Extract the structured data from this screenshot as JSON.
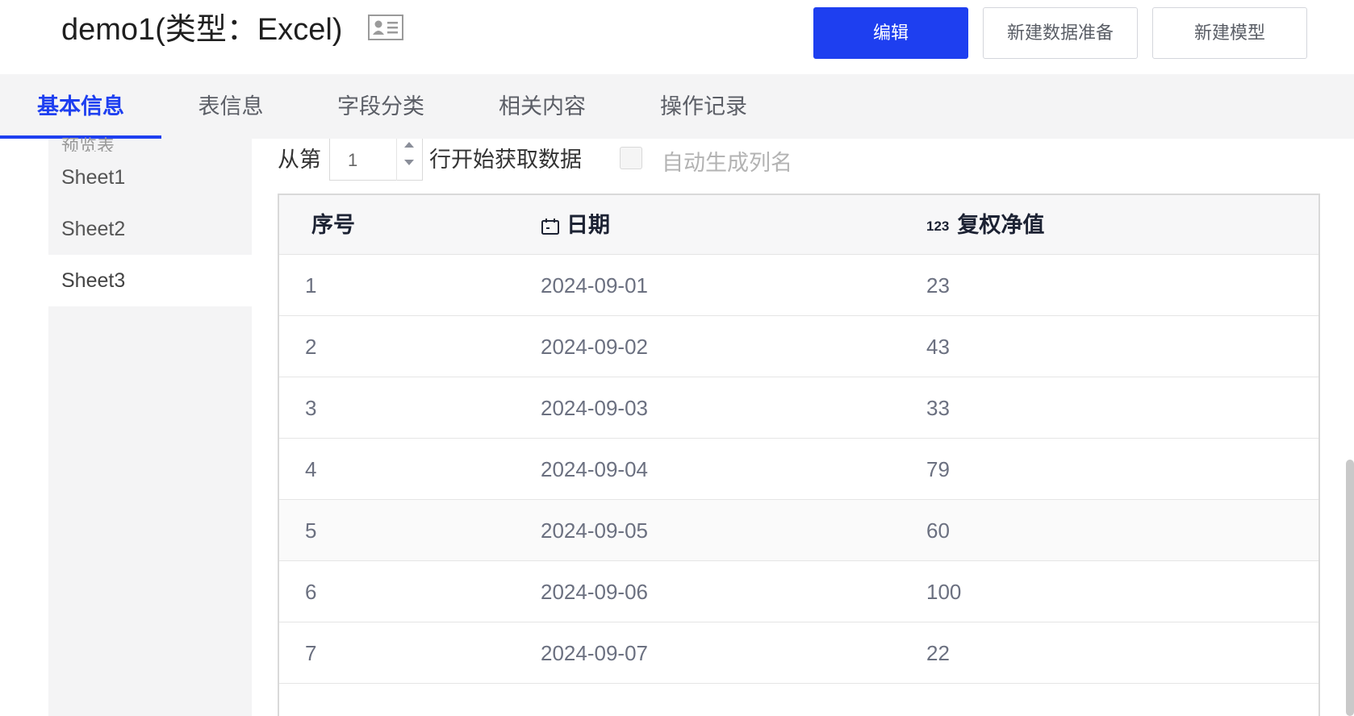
{
  "header": {
    "title": "demo1(类型：Excel)",
    "title_icon": "id-card-icon",
    "buttons": {
      "edit": "编辑",
      "new_prep": "新建数据准备",
      "new_model": "新建模型"
    }
  },
  "tabs": [
    {
      "label": "基本信息",
      "active": true
    },
    {
      "label": "表信息",
      "active": false
    },
    {
      "label": "字段分类",
      "active": false
    },
    {
      "label": "相关内容",
      "active": false
    },
    {
      "label": "操作记录",
      "active": false
    }
  ],
  "sidebar": {
    "heading": "预览表",
    "items": [
      {
        "label": "Sheet1",
        "active": false
      },
      {
        "label": "Sheet2",
        "active": false
      },
      {
        "label": "Sheet3",
        "active": true
      }
    ]
  },
  "controls": {
    "from_label": "从第",
    "start_row": "1",
    "after_label": "行开始获取数据",
    "auto_col_label": "自动生成列名",
    "auto_col_checked": false
  },
  "table": {
    "headers": [
      {
        "label": "序号",
        "icon": ""
      },
      {
        "label": "日期",
        "icon": "calendar-icon"
      },
      {
        "label": "复权净值",
        "icon": "number-123-icon",
        "icon_text": "123"
      }
    ],
    "rows": [
      [
        "1",
        "2024-09-01",
        "23"
      ],
      [
        "2",
        "2024-09-02",
        "43"
      ],
      [
        "3",
        "2024-09-03",
        "33"
      ],
      [
        "4",
        "2024-09-04",
        "79"
      ],
      [
        "5",
        "2024-09-05",
        "60"
      ],
      [
        "6",
        "2024-09-06",
        "100"
      ],
      [
        "7",
        "2024-09-07",
        "22"
      ]
    ]
  },
  "colors": {
    "accent": "#1e3ff0",
    "tab_bg": "#f4f4f5"
  }
}
